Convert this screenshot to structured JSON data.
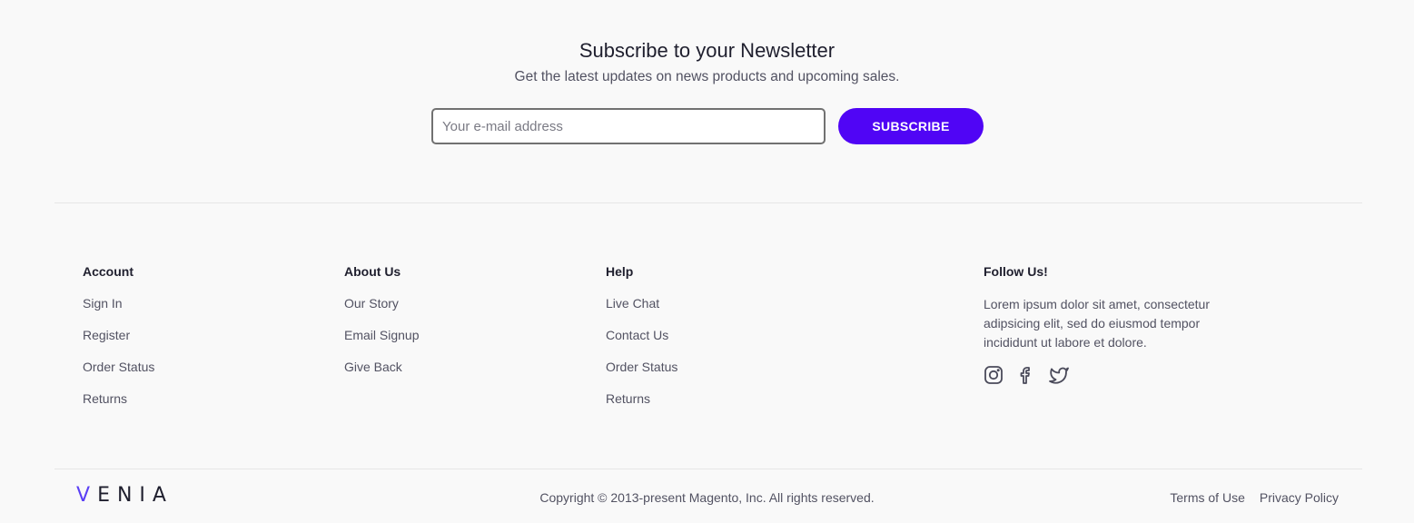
{
  "newsletter": {
    "title": "Subscribe to your Newsletter",
    "subtitle": "Get the latest updates on news products and upcoming sales.",
    "email_placeholder": "Your e-mail address",
    "email_value": "",
    "subscribe_label": "SUBSCRIBE"
  },
  "footer": {
    "columns": [
      {
        "heading": "Account",
        "links": [
          "Sign In",
          "Register",
          "Order Status",
          "Returns"
        ]
      },
      {
        "heading": "About Us",
        "links": [
          "Our Story",
          "Email Signup",
          "Give Back"
        ]
      },
      {
        "heading": "Help",
        "links": [
          "Live Chat",
          "Contact Us",
          "Order Status",
          "Returns"
        ]
      }
    ],
    "follow": {
      "heading": "Follow Us!",
      "text": "Lorem ipsum dolor sit amet, consectetur adipsicing elit, sed do eiusmod tempor incididunt ut labore et dolore.",
      "icons": [
        "instagram-icon",
        "facebook-icon",
        "twitter-icon"
      ]
    }
  },
  "bottom": {
    "logo_accent": "V",
    "logo_rest": "ENIA",
    "copyright": "Copyright © 2013-present Magento, Inc. All rights reserved.",
    "legal_links": [
      "Terms of Use",
      "Privacy Policy"
    ]
  },
  "colors": {
    "accent": "#5005f5",
    "background": "#f9f9f9",
    "text_dark": "#1f1f2e",
    "text_muted": "#525262"
  }
}
